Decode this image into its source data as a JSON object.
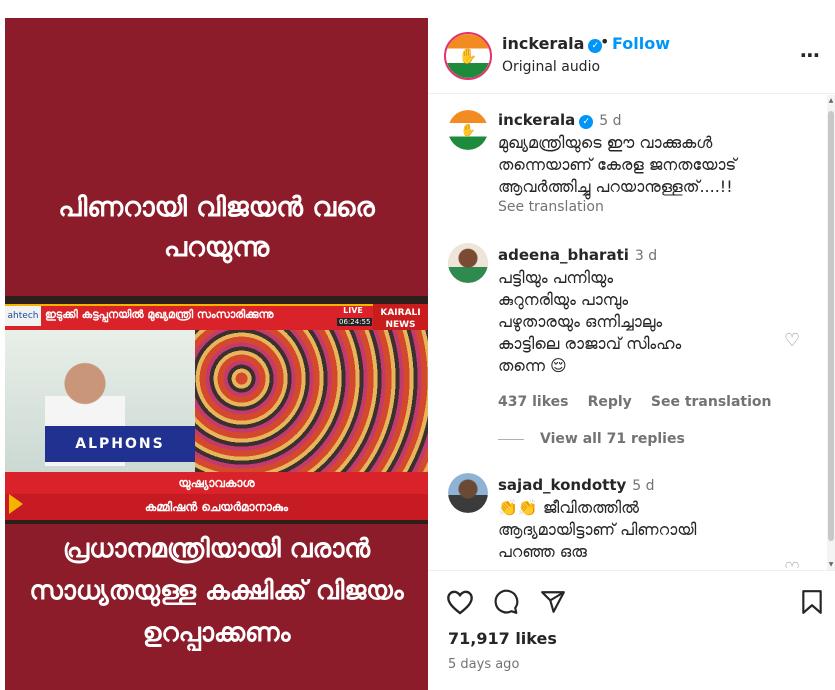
{
  "video": {
    "headline_top_line1": "പിണറായി വിജയൻ വരെ",
    "headline_top_line2": "പറയുന്നു",
    "ticker": "ഇടുക്കി കട്ടപ്പനയിൽ മുഖ്യമന്ത്രി സംസാരിക്കുന്നു",
    "logo_left": "ahtech",
    "live_label": "LIVE",
    "clock": "06:24:55",
    "channel_name": "KAIRALI NEWS",
    "podium_text": "ALPHONS",
    "caption_line1": "യുഷ്യാവകാശ",
    "caption_line2": "കമ്മിഷൻ ചെയർമാനാകും",
    "headline_bottom_line1": "പ്രധാനമന്ത്രിയായി വരാൻ",
    "headline_bottom_line2": "സാധ്യതയുള്ള കക്ഷിക്ക് വിജയം",
    "headline_bottom_line3": "ഉറപ്പാക്കണം",
    "brand_colors": {
      "background": "#8c1c2a",
      "bar": "#d9222a"
    }
  },
  "header": {
    "username": "inckerala",
    "separator": "•",
    "follow_label": "Follow",
    "audio_label": "Original audio",
    "more_icon": "⋯"
  },
  "comments": [
    {
      "username": "inckerala",
      "time": "5 d",
      "text_line1": "മുഖ്യമന്ത്രിയുടെ ഈ വാക്കുകൾ",
      "text_line2": "തന്നെയാണ് കേരള ജനതയോട്",
      "text_line3": "ആവർത്തിച്ചു പറയാനുള്ളത്....!!",
      "see_translation": "See translation"
    },
    {
      "username": "adeena_bharati",
      "time": "3 d",
      "text_line1": "പട്ടിയും പന്നിയും",
      "text_line2": "കുറുനരിയും പാമ്പും",
      "text_line3": "പഴുതാരയും ഒന്നിച്ചാലും",
      "text_line4": "കാട്ടിലെ രാജാവ് സിംഹം",
      "text_line5": "തന്നെ 😌",
      "likes": "437 likes",
      "reply": "Reply",
      "see_translation": "See translation",
      "view_replies": "View all 71 replies"
    },
    {
      "username": "sajad_kondotty",
      "time": "5 d",
      "text_line1": "👏👏 ജീവിതത്തിൽ",
      "text_line2": "ആദ്യമായിട്ടാണ് പിണറായി",
      "text_line3": "പറഞ്ഞ ഒരു"
    }
  ],
  "footer": {
    "likes": "71,917 likes",
    "posted": "5 days ago"
  }
}
